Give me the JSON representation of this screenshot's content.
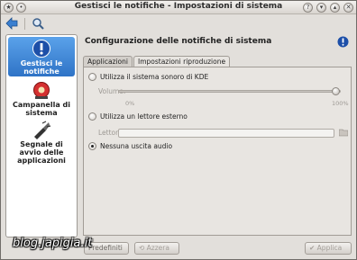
{
  "window": {
    "title": "Gestisci le notifiche - Impostazioni di sistema"
  },
  "sidebar": {
    "items": [
      {
        "label": "Gestisci le notifiche",
        "icon": "info-icon",
        "selected": true
      },
      {
        "label": "Campanella di sistema",
        "icon": "bell-icon",
        "selected": false
      },
      {
        "label": "Segnale di avvio delle applicazioni",
        "icon": "startup-icon",
        "selected": false
      }
    ]
  },
  "main": {
    "header": "Configurazione delle notifiche di sistema",
    "tabs": [
      {
        "label": "Applicazioni"
      },
      {
        "label": "Impostazioni riproduzione"
      }
    ],
    "options": {
      "kde_sound": "Utilizza il sistema sonoro di KDE",
      "volume_label": "Volume:",
      "volume_min": "0%",
      "volume_max": "100%",
      "volume_value": 100,
      "external_player": "Utilizza un lettore esterno",
      "player_label": "Lettore:",
      "player_value": "",
      "no_audio": "Nessuna uscita audio"
    }
  },
  "buttons": {
    "defaults": "Predefiniti",
    "reset": "Azzera",
    "apply": "Applica"
  },
  "watermark": "blog.japigia.it",
  "colors": {
    "accent": "#2f73c6",
    "bell": "#d43030"
  }
}
